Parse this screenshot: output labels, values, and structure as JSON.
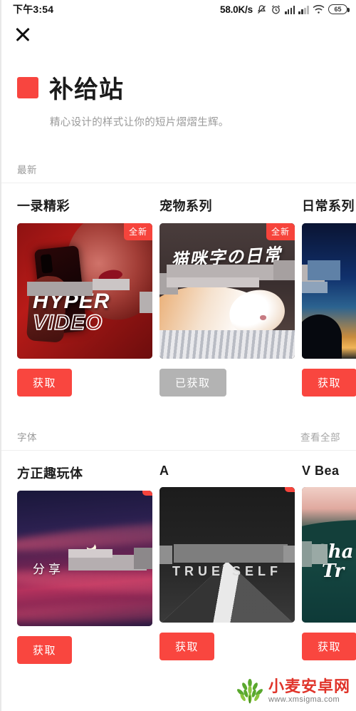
{
  "status_bar": {
    "time": "下午3:54",
    "network_speed": "58.0K/s",
    "icons": [
      "mute-icon",
      "alarm-icon",
      "signal-icon",
      "signal-icon-2",
      "wifi-icon"
    ],
    "battery_level": "65"
  },
  "nav": {
    "close_label": "close-icon"
  },
  "header": {
    "title": "补给站",
    "subtitle": "精心设计的样式让你的短片熠熠生辉。",
    "logo_color": "#F8453F"
  },
  "sections": [
    {
      "title": "最新",
      "more_label": "",
      "cards": [
        {
          "name": "一录精彩",
          "badge": "全新",
          "button": "获取",
          "button_state": "available",
          "art": "hyper",
          "art_text_1": "HYPER",
          "art_text_2": "VIDEO"
        },
        {
          "name": "宠物系列",
          "badge": "全新",
          "button": "已获取",
          "button_state": "obtained",
          "art": "cat",
          "art_text_1": "猫咪字の日常",
          "art_text_2": ""
        },
        {
          "name": "日常系列",
          "badge": "",
          "button": "获取",
          "button_state": "available",
          "art": "palm",
          "art_text_1": "",
          "art_text_2": ""
        }
      ]
    },
    {
      "title": "字体",
      "more_label": "查看全部",
      "cards": [
        {
          "name": "方正趣玩体",
          "badge": "",
          "button": "获取",
          "button_state": "available",
          "art": "sky",
          "art_text_1": "分享",
          "art_text_2": ""
        },
        {
          "name": "A",
          "badge": "",
          "button": "获取",
          "button_state": "available",
          "art": "mountain",
          "art_text_1": "TRUE SELF",
          "art_text_2": ""
        },
        {
          "name": "V   Bea",
          "badge": "",
          "button": "获取",
          "button_state": "available",
          "art": "teal",
          "art_text_1": "Sha",
          "art_text_2": "Tr"
        }
      ]
    }
  ],
  "watermark": {
    "name": "小麦安卓网",
    "url": "www.xmsigma.com"
  }
}
